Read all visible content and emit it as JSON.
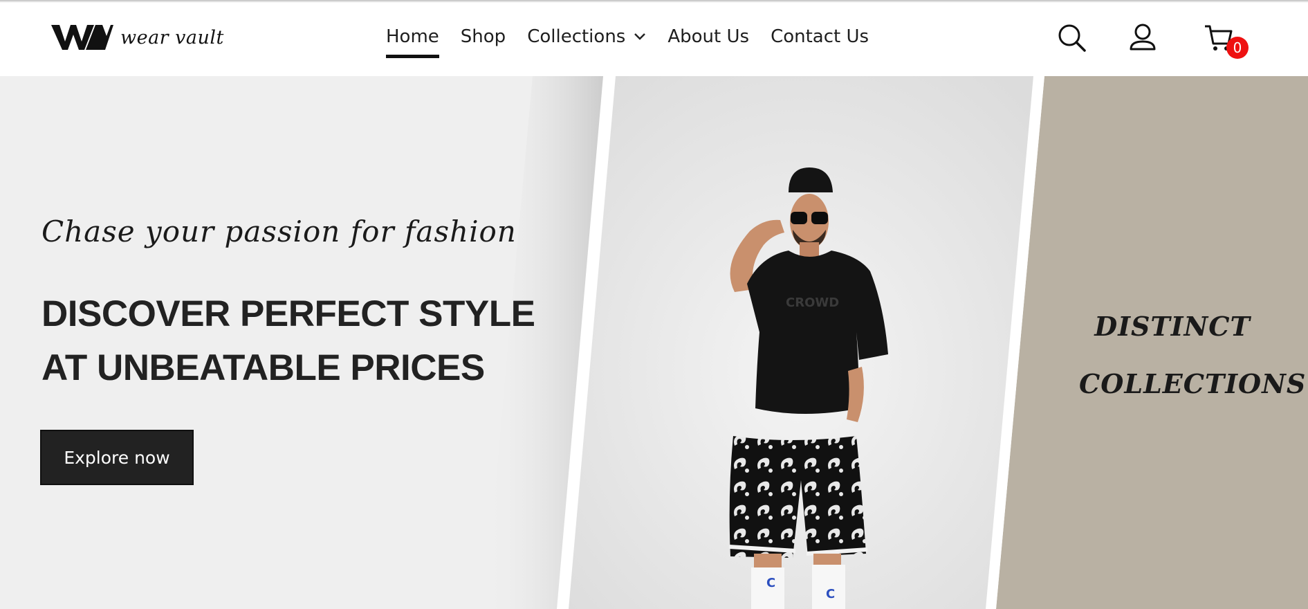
{
  "brand": {
    "name": "wear vault"
  },
  "nav": {
    "items": [
      {
        "label": "Home",
        "active": true
      },
      {
        "label": "Shop"
      },
      {
        "label": "Collections",
        "has_dropdown": true
      },
      {
        "label": "About Us"
      },
      {
        "label": "Contact Us"
      }
    ]
  },
  "header_icons": {
    "search": "search-icon",
    "account": "user-icon",
    "cart": "cart-icon"
  },
  "cart": {
    "count": "0"
  },
  "hero": {
    "tagline": "Chase your passion for fashion",
    "headline_line1": "DISCOVER PERFECT STYLE",
    "headline_line2": "AT UNBEATABLE PRICES",
    "cta_label": "Explore now",
    "side_text_line1": "DISTINCT",
    "side_text_line2": "COLLECTIONS"
  },
  "colors": {
    "hero_left_bg": "#efefef",
    "hero_right_bg": "#b9b1a3",
    "cta_bg": "#222222",
    "badge_bg": "#ee1111"
  }
}
